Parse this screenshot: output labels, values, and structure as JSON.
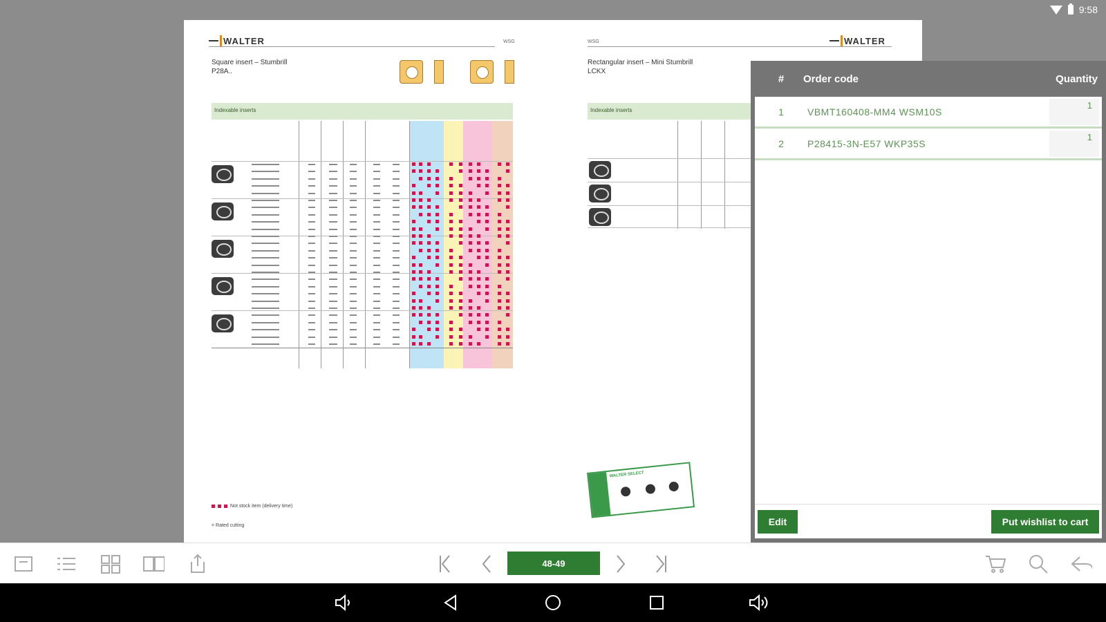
{
  "status_bar": {
    "time": "9:58"
  },
  "catalog": {
    "left_page": {
      "logo": "WALTER",
      "page_label": "WSG",
      "title_line1": "Square insert – Stumbrill",
      "title_line2": "P28A..",
      "section_bar": "Indexable inserts",
      "legend": "Not stock item (delivery time)",
      "footnote": "= Rated cutting"
    },
    "right_page": {
      "logo": "WALTER",
      "page_label": "WSG",
      "title_line1": "Rectangular insert – Mini Stumbrill",
      "title_line2": "LCKX",
      "section_bar": "Indexable inserts",
      "stamp_text": "WALTER SELECT"
    }
  },
  "wishlist": {
    "header": {
      "num": "#",
      "code": "Order code",
      "qty": "Quantity"
    },
    "items": [
      {
        "num": "1",
        "code": "VBMT160408-MM4 WSM10S",
        "qty": "1"
      },
      {
        "num": "2",
        "code": "P28415-3N-E57 WKP35S",
        "qty": "1"
      }
    ],
    "edit_label": "Edit",
    "cart_label": "Put wishlist to cart"
  },
  "toolbar": {
    "page_indicator": "48-49",
    "icons": [
      "home-icon",
      "list-icon",
      "grid-icon",
      "book-icon",
      "share-icon",
      "first-page-icon",
      "prev-page-icon",
      "next-page-icon",
      "last-page-icon",
      "cart-icon",
      "search-icon",
      "back-icon"
    ]
  },
  "colors": {
    "accent_green": "#2f7d32",
    "row_text_green": "#5d9455",
    "panel_gray": "#757575",
    "background_gray": "#8c8c8c",
    "dot_red": "#d0154e"
  }
}
